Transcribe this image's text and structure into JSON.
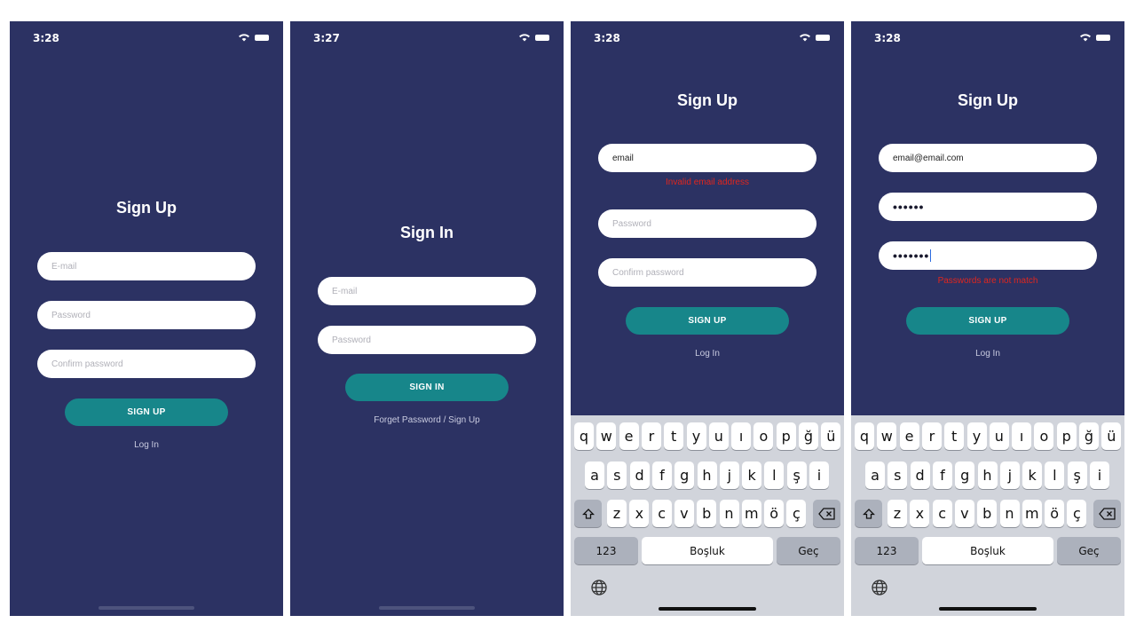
{
  "status": {
    "phone1_time": "3:28",
    "phone2_time": "3:27",
    "phone3_time": "3:28",
    "phone4_time": "3:28"
  },
  "phone1": {
    "title": "Sign Up",
    "email_placeholder": "E-mail",
    "password_placeholder": "Password",
    "confirm_placeholder": "Confirm password",
    "button_label": "SIGN UP",
    "link_label": "Log In"
  },
  "phone2": {
    "title": "Sign In",
    "email_placeholder": "E-mail",
    "password_placeholder": "Password",
    "button_label": "SIGN IN",
    "link_label": "Forget Password / Sign Up"
  },
  "phone3": {
    "title": "Sign Up",
    "email_value": "email",
    "email_error": "Invalid email address",
    "password_placeholder": "Password",
    "confirm_placeholder": "Confirm password",
    "button_label": "SIGN UP",
    "link_label": "Log In"
  },
  "phone4": {
    "title": "Sign Up",
    "email_value": "email@email.com",
    "password_value": "••••••",
    "confirm_value": "•••••••",
    "confirm_error": "Passwords are not match",
    "button_label": "SIGN UP",
    "link_label": "Log In"
  },
  "keyboard": {
    "row1": [
      "q",
      "w",
      "e",
      "r",
      "t",
      "y",
      "u",
      "ı",
      "o",
      "p",
      "ğ",
      "ü"
    ],
    "row2": [
      "a",
      "s",
      "d",
      "f",
      "g",
      "h",
      "j",
      "k",
      "l",
      "ş",
      "i"
    ],
    "row3": [
      "z",
      "x",
      "c",
      "v",
      "b",
      "n",
      "m",
      "ö",
      "ç"
    ],
    "numbers_label": "123",
    "space_label": "Boşluk",
    "return_label": "Geç",
    "shift_icon": "shift-icon",
    "delete_icon": "delete-icon",
    "globe_icon": "globe-icon"
  },
  "colors": {
    "background": "#2c3263",
    "accent": "#17868a",
    "error": "#e0261e",
    "field": "#ffffff"
  }
}
